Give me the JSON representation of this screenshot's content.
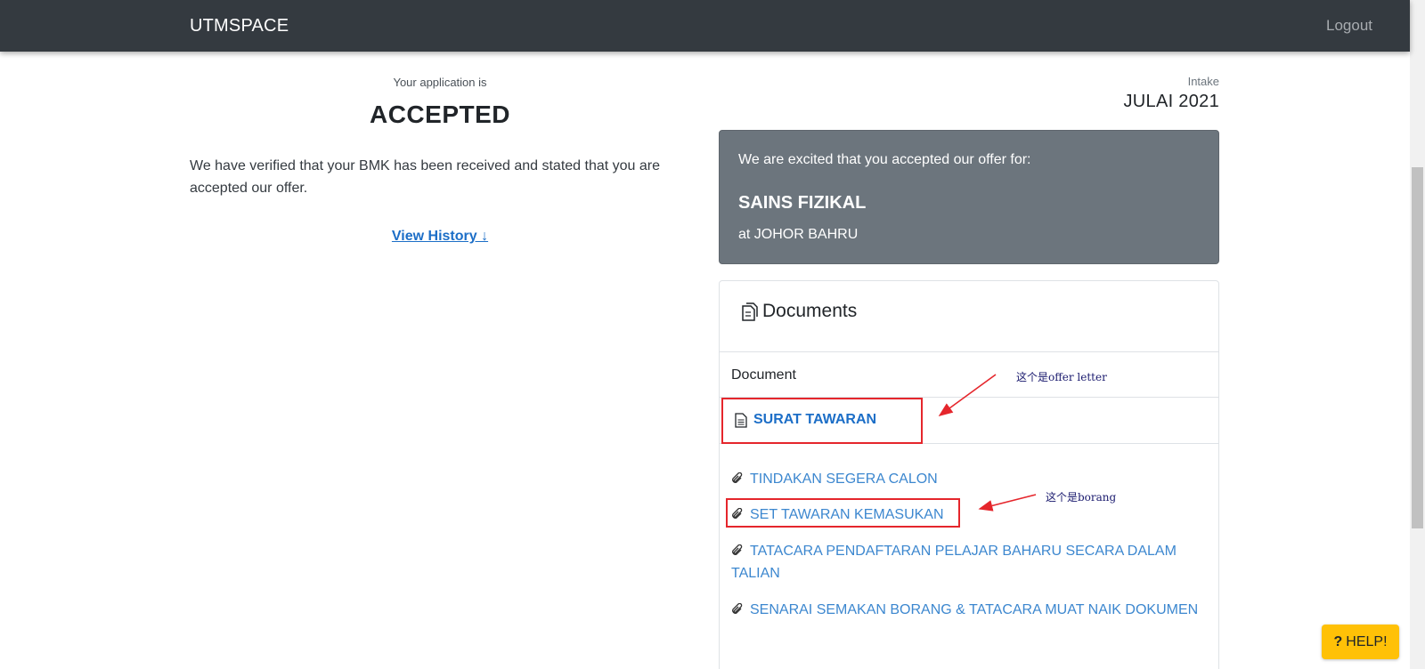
{
  "navbar": {
    "brand": "UTMSPACE",
    "logout_label": "Logout"
  },
  "application": {
    "status_caption": "Your application is",
    "status_value": "ACCEPTED",
    "message": "We have verified that your BMK has been received and stated that you are accepted our offer.",
    "history_link": "View History ↓"
  },
  "intake": {
    "caption": "Intake",
    "value": "JULAI 2021"
  },
  "offer": {
    "intro": "We are excited that you accepted our offer for:",
    "program": "SAINS FIZIKAL",
    "campus": "at JOHOR BAHRU"
  },
  "documents": {
    "title": "Documents",
    "title_icon": "copy-documents-icon",
    "column_header": "Document",
    "main_document": {
      "label": "SURAT TAWARAN",
      "icon": "file-text-icon"
    },
    "attachments": [
      {
        "label": "TINDAKAN SEGERA CALON",
        "icon": "paperclip-icon"
      },
      {
        "label": "SET TAWARAN KEMASUKAN",
        "icon": "paperclip-icon"
      },
      {
        "label": "TATACARA PENDAFTARAN PELAJAR BAHARU SECARA DALAM TALIAN",
        "icon": "paperclip-icon"
      },
      {
        "label": "SENARAI SEMAKAN BORANG & TATACARA MUAT NAIK DOKUMEN",
        "icon": "paperclip-icon"
      }
    ]
  },
  "annotations": {
    "offer_letter_note": "这个是offer letter",
    "borang_note": "这个是borang",
    "color": "#e5262c"
  },
  "help": {
    "icon": "?",
    "label": "HELP!"
  },
  "colors": {
    "navbar": "#343a40",
    "offer_card": "#6c757d",
    "link": "#1c6ec7",
    "help_button": "#ffc107"
  }
}
